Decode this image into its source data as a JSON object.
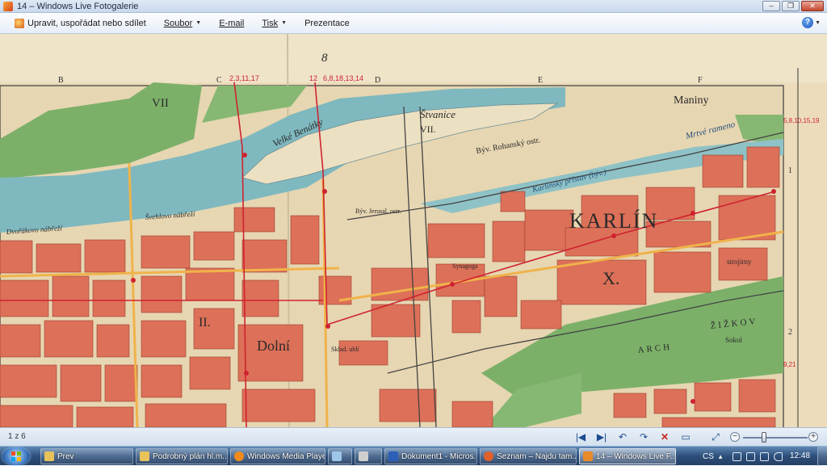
{
  "window": {
    "title": "14 – Windows Live Fotogalerie",
    "controls": {
      "minimize": "–",
      "maximize": "❐",
      "close": "✕"
    }
  },
  "menu": {
    "items": [
      {
        "label": "Upravit, uspořádat nebo sdílet",
        "icon": "photo-edit-icon"
      },
      {
        "label": "Soubor",
        "has_dropdown": true
      },
      {
        "label": "E-mail",
        "has_dropdown": false
      },
      {
        "label": "Tisk",
        "has_dropdown": true
      },
      {
        "label": "Prezentace",
        "has_dropdown": false
      }
    ],
    "help_glyph": "?"
  },
  "map": {
    "grid_letters": [
      "B",
      "C",
      "D",
      "E",
      "F"
    ],
    "grid_numbers": [
      "1",
      "2"
    ],
    "sheet_number": "8",
    "tram_lines": [
      "2,3,11,17",
      "12",
      "6,8,18,13,14",
      "5,8,10,15,19",
      "9,21"
    ],
    "labels": {
      "district_vii_left": "VII",
      "district_vii_island": "VII.",
      "district_ii": "II.",
      "district_x": "X.",
      "karlin": "KARLÍN",
      "dolni": "Dolní",
      "stvanice": "Štvanice",
      "velke_benatky": "Velké Benátky",
      "maniny": "Maniny",
      "mrtve_rameno": "Mrtvé rameno",
      "karlinsky_pristav": "Karlínský přístav (býv.)",
      "byv_rohansky_ostr": "Býv. Rohanský ostr.",
      "svehlovo_nabrezi": "Švehlovo nábřeží",
      "dvorakovo_nabrezi": "Dvořákovo nábřeží",
      "zizkov": "ŽIŽKOV",
      "arch": "ARCH",
      "sokol": "Sokol",
      "synagoga": "Synagoga",
      "strojirny": "strojírny",
      "sklad_uhli": "Sklad. uhlí",
      "byv_jerusalem": "Býv. Jerusal. ostr."
    }
  },
  "viewer_controls": {
    "counter": "1 z 6",
    "buttons": [
      "|◀",
      "▶|",
      "↶",
      "↷",
      "✕",
      "▭",
      "⤢",
      "−",
      "+"
    ]
  },
  "taskbar": {
    "items": [
      {
        "label": "Prev",
        "icon_color": "#e8c35a"
      },
      {
        "label": "Podrobný plán hl.m....",
        "icon_color": "#e8c35a"
      },
      {
        "label": "Windows Media Player",
        "icon_color": "#f08a1c"
      },
      {
        "label": "",
        "icon_color": "#9fc6e8"
      },
      {
        "label": "",
        "icon_color": "#cfcfcf"
      },
      {
        "label": "Dokument1 - Micros...",
        "icon_color": "#2b5fb8"
      },
      {
        "label": "Seznam – Najdu tam...",
        "icon_color": "#e2602a"
      },
      {
        "label": "14 – Windows Live F...",
        "icon_color": "#e98a2a"
      }
    ],
    "language": "CS",
    "clock": "12:48"
  },
  "colors": {
    "map_blocks": "#dd7058",
    "map_paper": "#ecdcbb",
    "map_green": "#7cb069",
    "map_water": "#7fb9bf",
    "map_red_text": "#cf2230"
  }
}
